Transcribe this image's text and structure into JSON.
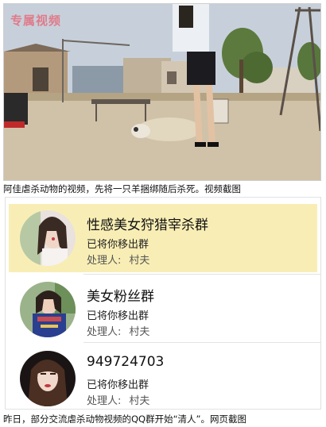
{
  "video": {
    "watermark": "专属视频"
  },
  "caption_top": "阿佳虐杀动物的视频，先将一只羊捆绑随后杀死。视频截图",
  "groups": [
    {
      "name": "性感美女狩猎宰杀群",
      "status": "已将你移出群",
      "handler_label": "处理人:",
      "handler": "村夫",
      "highlighted": true
    },
    {
      "name": "美女粉丝群",
      "status": "已将你移出群",
      "handler_label": "处理人:",
      "handler": "村夫",
      "highlighted": false
    },
    {
      "name": "949724703",
      "status": "已将你移出群",
      "handler_label": "处理人:",
      "handler": "村夫",
      "highlighted": false
    }
  ],
  "caption_bottom": "昨日，部分交流虐杀动物视频的QQ群开始“清人”。网页截图",
  "colors": {
    "highlight": "#f8eeb5",
    "watermark": "#e07a8a"
  }
}
